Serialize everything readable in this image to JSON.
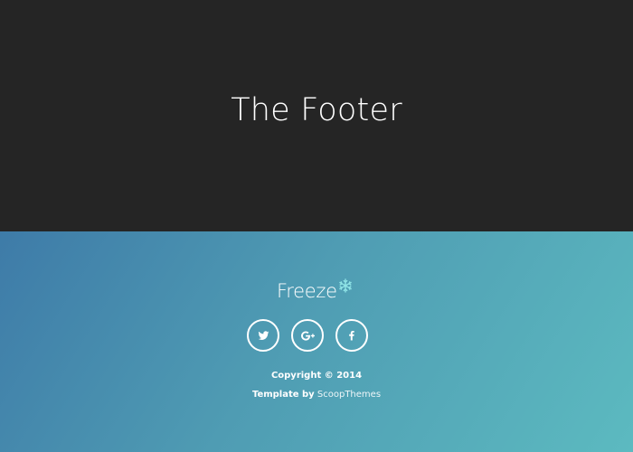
{
  "hero": {
    "title": "The Footer"
  },
  "footer": {
    "logo_text": "Freeze",
    "social_links": [
      {
        "name": "twitter",
        "icon": "twitter-icon"
      },
      {
        "name": "google-plus",
        "icon": "google-plus-icon"
      },
      {
        "name": "facebook",
        "icon": "facebook-icon"
      }
    ],
    "copyright": "Copyright © 2014",
    "credit_prefix": "Template by",
    "credit_link": "ScoopThemes"
  },
  "colors": {
    "hero_bg": "#252525",
    "footer_gradient_start": "#3e7ba8",
    "footer_gradient_end": "#5cbac0",
    "snowflake": "#8fe3e6",
    "text": "#ffffff"
  }
}
